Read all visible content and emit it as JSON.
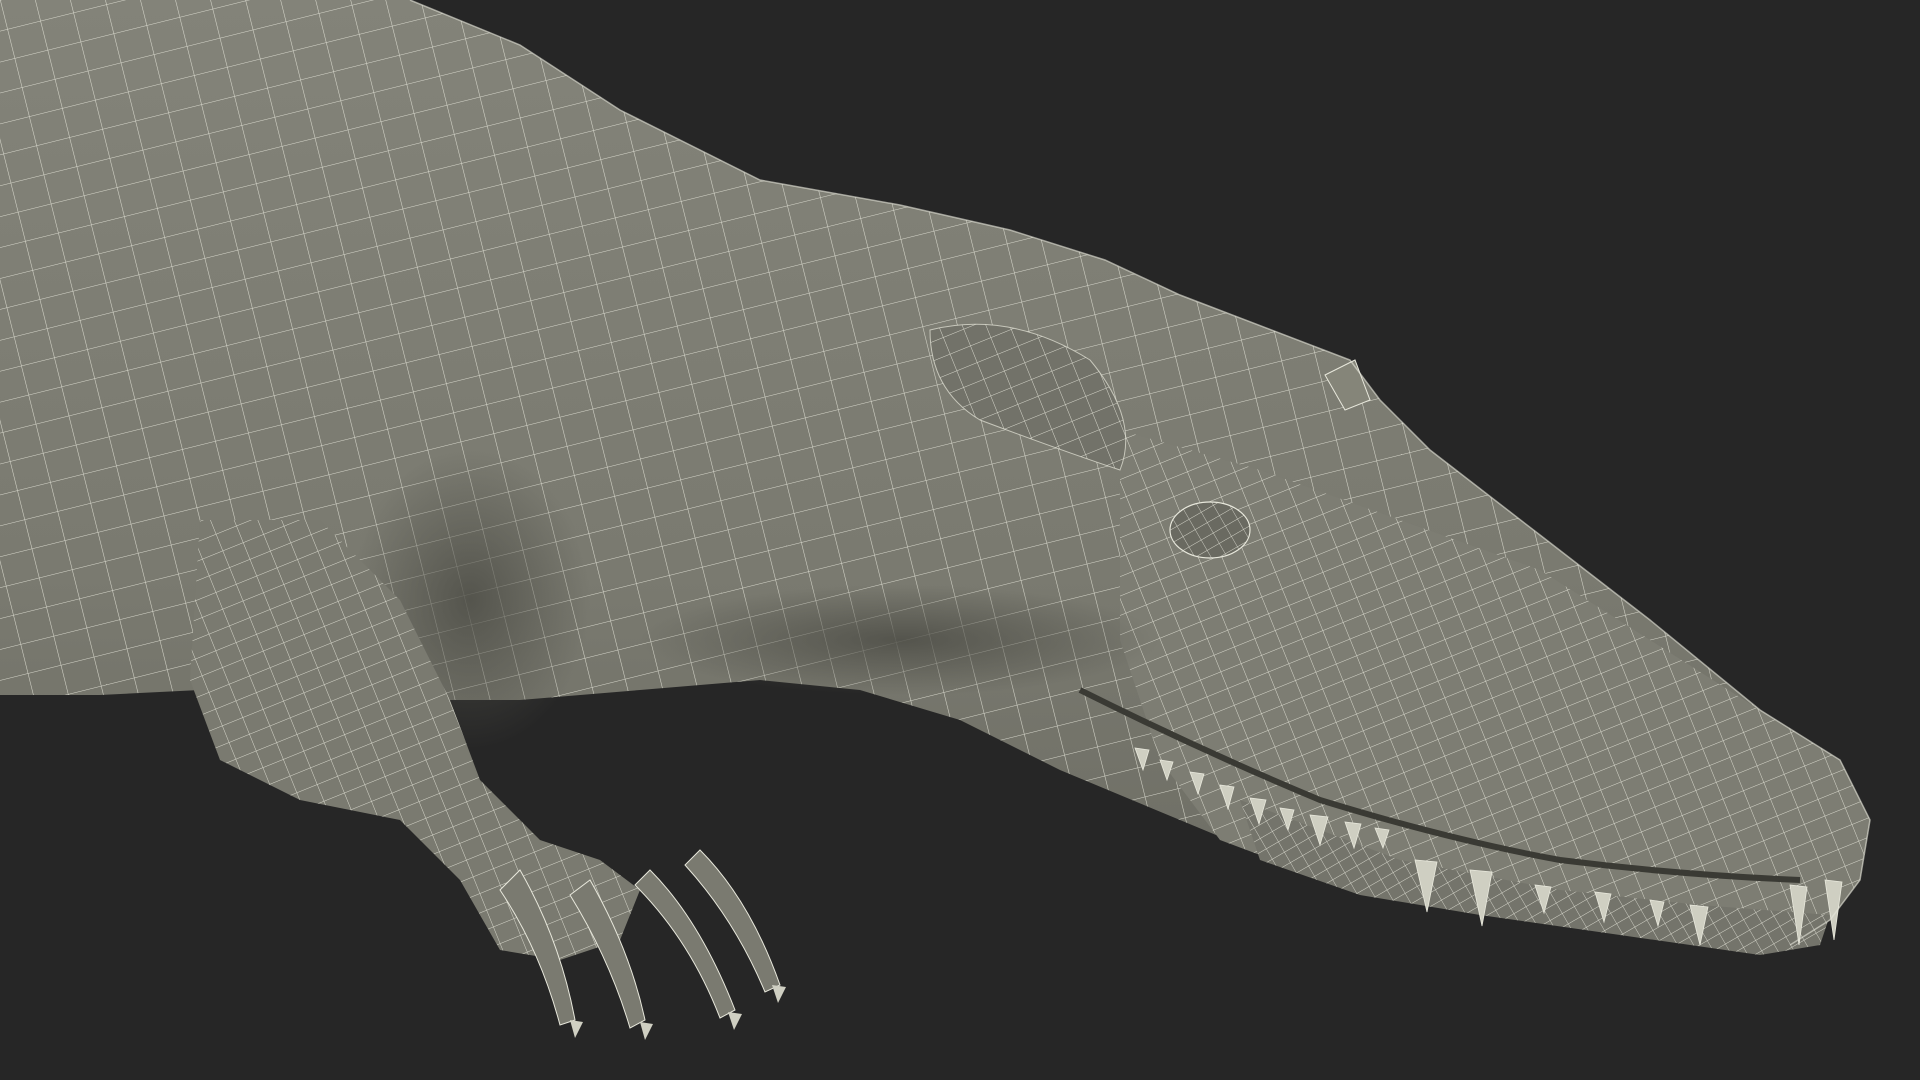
{
  "scene": {
    "subject": "crocodile-head-wireframe",
    "colors": {
      "background": "#262626",
      "mesh_fill": "#7c7c72",
      "mesh_shade": "#5e5e56",
      "mesh_highlight": "#8e8e84",
      "wire": "#e8e8dc",
      "teeth": "#cfcfc2",
      "mouth_dark": "#3a3a34"
    }
  }
}
